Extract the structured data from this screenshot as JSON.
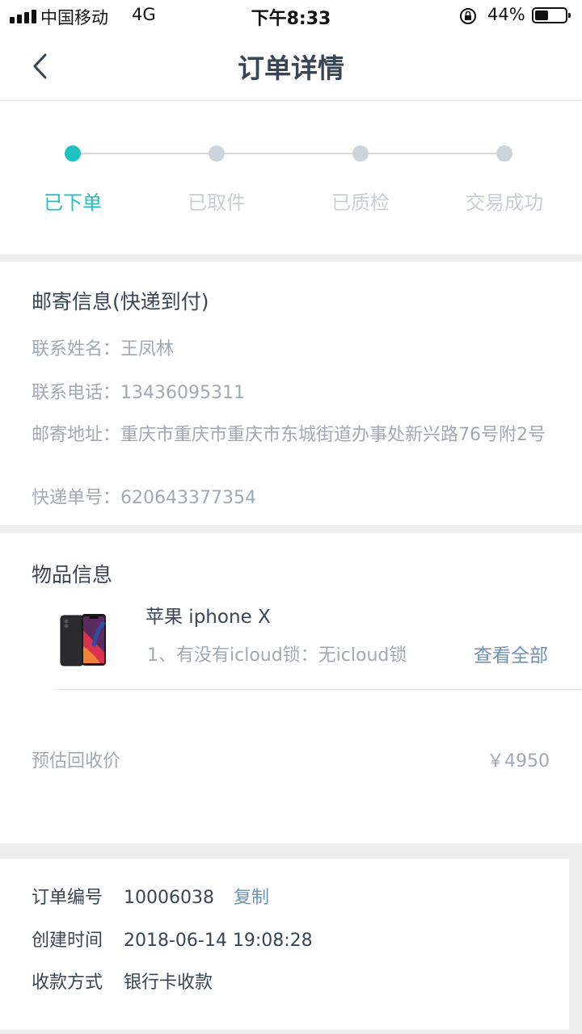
{
  "status_bar": {
    "carrier": "中国移动",
    "network": "4G",
    "time": "下午8:33",
    "battery": "44%",
    "battery_level": 0.44
  },
  "nav": {
    "title": "订单详情",
    "back_icon": "chevron-left-icon"
  },
  "progress": {
    "active_index": 0,
    "accent_color": "#1fc2c0",
    "steps": [
      {
        "label": "已下单"
      },
      {
        "label": "已取件"
      },
      {
        "label": "已质检"
      },
      {
        "label": "交易成功"
      }
    ]
  },
  "mail": {
    "title": "邮寄信息(快递到付)",
    "contact_name_label": "联系姓名：",
    "contact_name": "王凤林",
    "phone_label": "联系电话：",
    "phone": "13436095311",
    "address_label": "邮寄地址：",
    "address": "重庆市重庆市重庆市东城街道办事处新兴路76号附2号",
    "tracking_label": "快递单号：",
    "tracking": "620643377354"
  },
  "goods": {
    "title": "物品信息",
    "image_icon": "phone-image",
    "name": "苹果 iphone X",
    "attr": "1、有没有icloud锁：无icloud锁",
    "view_all": "查看全部",
    "estimate_label": "预估回收价",
    "estimate_value": "￥4950"
  },
  "order": {
    "number_label": "订单编号",
    "number": "10006038",
    "copy": "复制",
    "created_label": "创建时间",
    "created": "2018-06-14 19:08:28",
    "payment_label": "收款方式",
    "payment": "银行卡收款"
  }
}
